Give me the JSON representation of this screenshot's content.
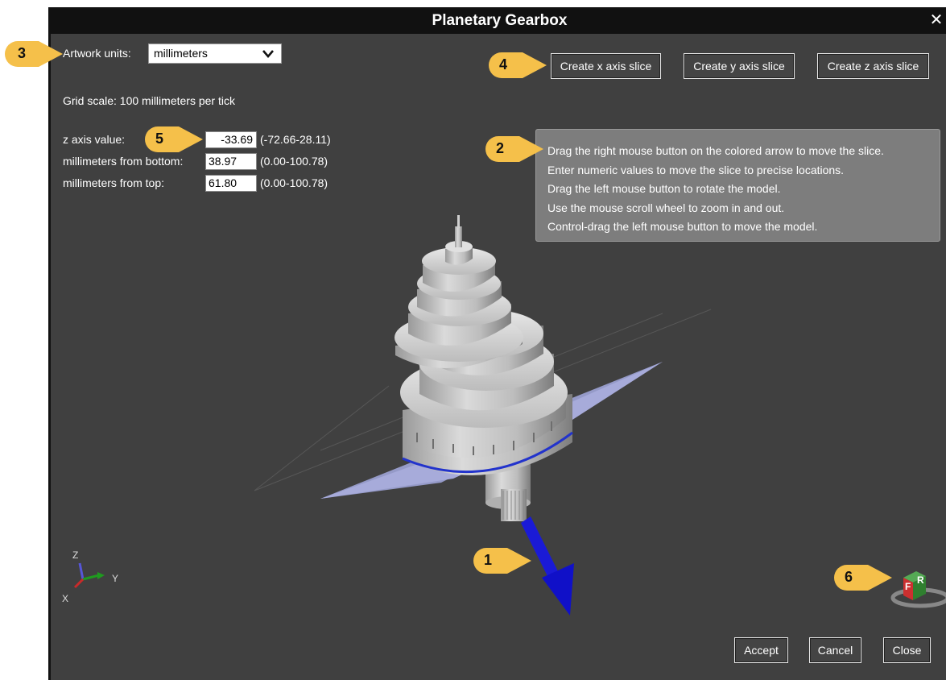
{
  "window": {
    "title": "Planetary Gearbox",
    "close_glyph": "✕"
  },
  "settings": {
    "units_label": "Artwork units:",
    "units_value": "millimeters",
    "grid_scale": "Grid scale: 100 millimeters per tick"
  },
  "slice_fields": [
    {
      "label": "z axis value:",
      "value": "-33.69",
      "range": "(-72.66-28.11)"
    },
    {
      "label": "millimeters from bottom:",
      "value": "38.97",
      "range": "(0.00-100.78)"
    },
    {
      "label": "millimeters from top:",
      "value": "61.80",
      "range": "(0.00-100.78)"
    }
  ],
  "slice_buttons": {
    "x": "Create x axis slice",
    "y": "Create y axis slice",
    "z": "Create z axis slice"
  },
  "help_text": [
    "Drag the right mouse button on the colored arrow to move the slice.",
    "Enter numeric values to move the slice to precise locations.",
    "Drag the left mouse button to rotate the model.",
    "Use the mouse scroll wheel to zoom in and out.",
    "Control-drag the left mouse button to move the model."
  ],
  "axes": {
    "z": "Z",
    "y": "Y",
    "x": "X"
  },
  "view_cube": {
    "front": "F",
    "right": "R"
  },
  "footer_buttons": {
    "accept": "Accept",
    "cancel": "Cancel",
    "close": "Close"
  },
  "callouts": [
    "1",
    "2",
    "3",
    "4",
    "5",
    "6"
  ],
  "colors": {
    "callout": "#f5c04a",
    "background": "#404040",
    "titlebar": "#111111",
    "slice_plane": "#9a9fd0",
    "arrow": "#1a1ad6",
    "tooltip": "#7d7d7d"
  },
  "icons": [
    "chevron-down-icon",
    "close-icon",
    "axis-triad-icon",
    "view-cube-icon",
    "slice-arrow-icon"
  ]
}
